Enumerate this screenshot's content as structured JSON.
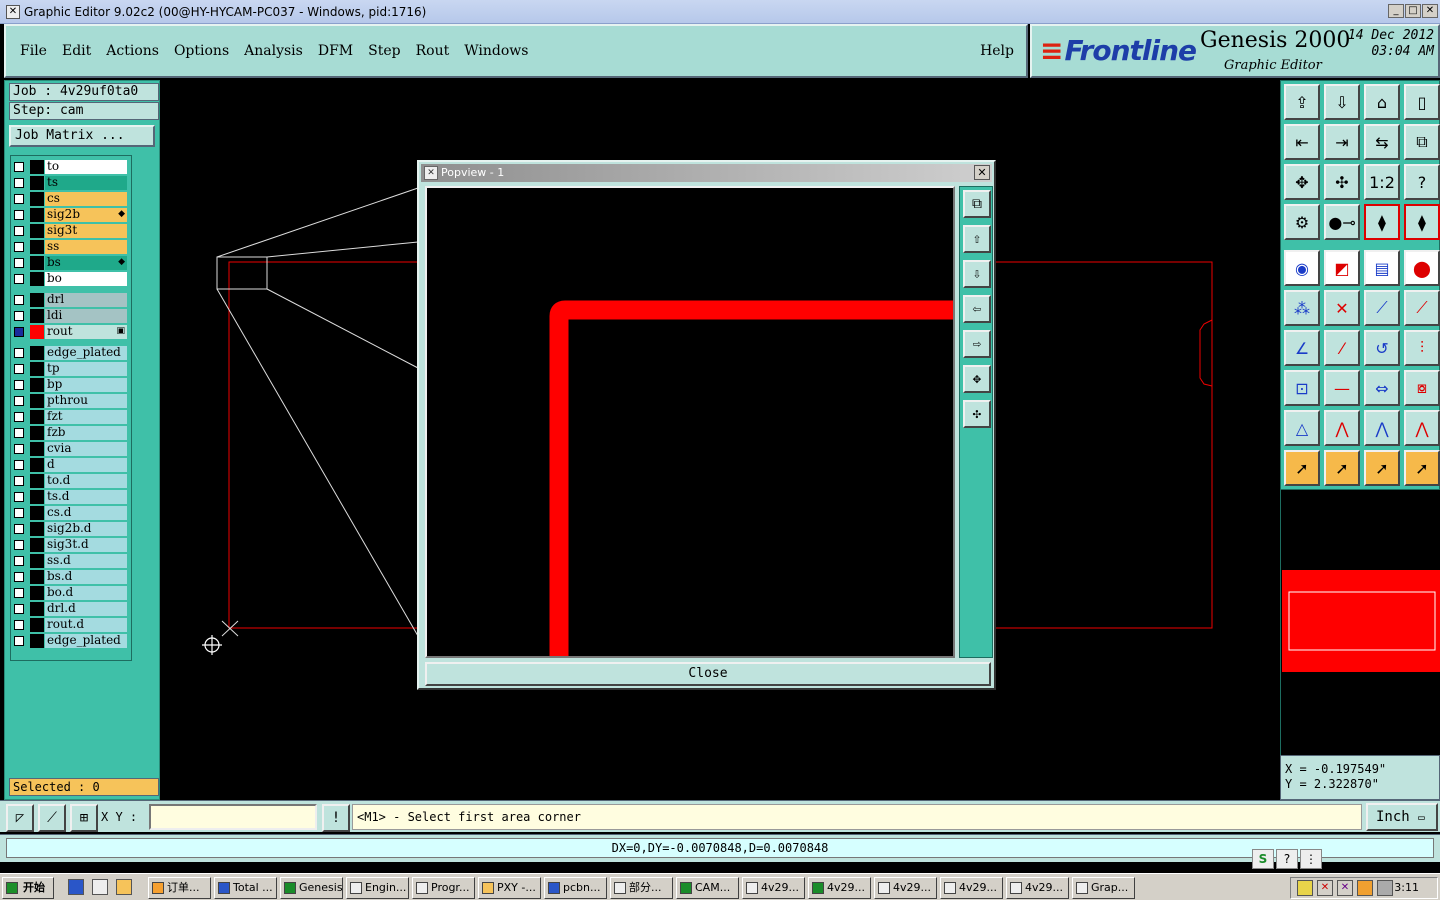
{
  "window": {
    "title": "Graphic Editor 9.02c2 (00@HY-HYCAM-PC037 - Windows, pid:1716)"
  },
  "menu": [
    "File",
    "Edit",
    "Actions",
    "Options",
    "Analysis",
    "DFM",
    "Step",
    "Rout",
    "Windows"
  ],
  "help_label": "Help",
  "logo": {
    "brand": "Frontline",
    "product": "Genesis 2000",
    "subtitle": "Graphic Editor",
    "date": "14 Dec 2012",
    "time": "03:04 AM"
  },
  "job": {
    "job_line": "Job : 4v29uf0ta0",
    "step_line": "Step: cam",
    "matrix_label": "Job Matrix ..."
  },
  "layers": [
    {
      "name": "to",
      "color": "#ffffff",
      "mark": ""
    },
    {
      "name": "ts",
      "color": "#1fa98a",
      "mark": ""
    },
    {
      "name": "cs",
      "color": "#f6c35a",
      "mark": ""
    },
    {
      "name": "sig2b",
      "color": "#f6c35a",
      "mark": "◆"
    },
    {
      "name": "sig3t",
      "color": "#f6c35a",
      "mark": ""
    },
    {
      "name": "ss",
      "color": "#f6c35a",
      "mark": ""
    },
    {
      "name": "bs",
      "color": "#1fa98a",
      "mark": "◆"
    },
    {
      "name": "bo",
      "color": "#ffffff",
      "mark": ""
    },
    {
      "name": "drl",
      "color": "#a4c3c4",
      "mark": ""
    },
    {
      "name": "ldi",
      "color": "#a4c3c4",
      "mark": ""
    },
    {
      "name": "rout",
      "color": "#bfe3dd",
      "mark": "▣"
    },
    {
      "name": "edge_plated",
      "color": "#a4dbe0",
      "mark": ""
    },
    {
      "name": "tp",
      "color": "#a4dbe0",
      "mark": ""
    },
    {
      "name": "bp",
      "color": "#a4dbe0",
      "mark": ""
    },
    {
      "name": "pthrou",
      "color": "#a4dbe0",
      "mark": ""
    },
    {
      "name": "fzt",
      "color": "#a4dbe0",
      "mark": ""
    },
    {
      "name": "fzb",
      "color": "#a4dbe0",
      "mark": ""
    },
    {
      "name": "cvia",
      "color": "#a4dbe0",
      "mark": ""
    },
    {
      "name": "d",
      "color": "#a4dbe0",
      "mark": ""
    },
    {
      "name": "to.d",
      "color": "#a4dbe0",
      "mark": ""
    },
    {
      "name": "ts.d",
      "color": "#a4dbe0",
      "mark": ""
    },
    {
      "name": "cs.d",
      "color": "#a4dbe0",
      "mark": ""
    },
    {
      "name": "sig2b.d",
      "color": "#a4dbe0",
      "mark": ""
    },
    {
      "name": "sig3t.d",
      "color": "#a4dbe0",
      "mark": ""
    },
    {
      "name": "ss.d",
      "color": "#a4dbe0",
      "mark": ""
    },
    {
      "name": "bs.d",
      "color": "#a4dbe0",
      "mark": ""
    },
    {
      "name": "bo.d",
      "color": "#a4dbe0",
      "mark": ""
    },
    {
      "name": "drl.d",
      "color": "#a4dbe0",
      "mark": ""
    },
    {
      "name": "rout.d",
      "color": "#a4dbe0",
      "mark": ""
    },
    {
      "name": "edge_plated",
      "color": "#a4dbe0",
      "mark": ""
    }
  ],
  "selected_label": "Selected : 0",
  "popup": {
    "title": "Popview - 1",
    "close_label": "Close"
  },
  "coords": {
    "x": "X = -0.197549\"",
    "y": "Y = 2.322870\""
  },
  "command": {
    "xy_label": "X Y :",
    "xy_value": "",
    "prompt": "<M1> - Select first area corner",
    "unit": "Inch"
  },
  "status_text": "DX=0,DY=-0.0070848,D=0.0070848",
  "taskbar": {
    "start": "开始",
    "tasks": [
      "订单...",
      "Total ...",
      "Genesis",
      "Engin...",
      "Progr...",
      "PXY -...",
      "pcbn...",
      "部分...",
      "CAM...",
      "4v29...",
      "4v29...",
      "4v29...",
      "4v29...",
      "4v29...",
      "Grap..."
    ],
    "clock": "3:11"
  },
  "icons": {
    "toolbar": [
      "open-icon",
      "save-icon",
      "home-icon",
      "window-icon",
      "left-icon",
      "right-icon",
      "swap-icon",
      "snap-icon",
      "fit-icon",
      "zoom-icon",
      "one-to-one-icon",
      "help-icon",
      "settings-icon",
      "measure-icon",
      "layer-a-icon",
      "layer-b-icon",
      "select-dot-icon",
      "highlight-icon",
      "ruler-icon",
      "pad-icon",
      "nodes-icon",
      "cross-icon",
      "connect-icon",
      "connect2-icon",
      "line-icon",
      "slash-icon",
      "arc-icon",
      "hook-icon",
      "square-dot-icon",
      "dash-icon",
      "resize-icon",
      "group-icon",
      "triangle1-icon",
      "triangle2-icon",
      "triangle3-icon",
      "triangle4-icon",
      "pointer-icon",
      "pointer-box-icon",
      "pointer-circle-icon",
      "pointer-path-icon"
    ]
  },
  "colors": {
    "panel": "#3fc0a8",
    "menu": "#a7dcd4",
    "accent_red": "#ff0000"
  }
}
